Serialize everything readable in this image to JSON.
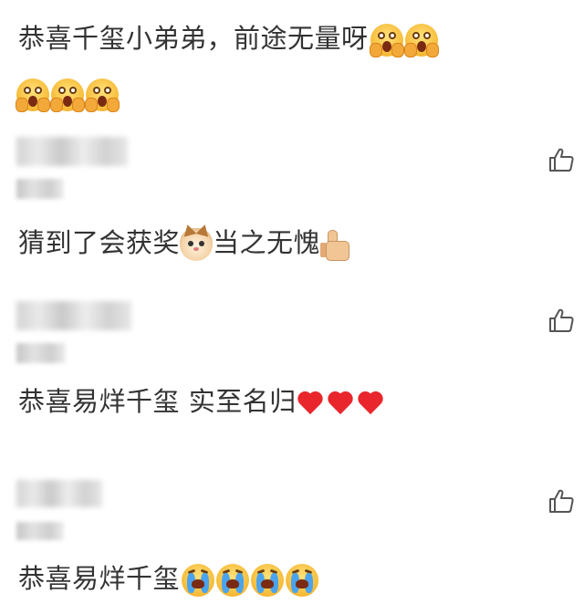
{
  "post": {
    "text_line1": "恭喜千玺小弟弟，前途无量呀",
    "line1_emoji": [
      "shocked-face-emoji",
      "shocked-face-emoji"
    ],
    "line2_emoji": [
      "shocked-face-emoji",
      "shocked-face-emoji",
      "shocked-face-emoji"
    ]
  },
  "comments": [
    {
      "text_a": "猜到了会获奖",
      "text_b": "当之无愧",
      "emoji": [
        "cat-face-emoji",
        "thumbs-up-emoji"
      ]
    },
    {
      "text": "恭喜易烊千玺 实至名归",
      "emoji": [
        "red-heart-emoji",
        "red-heart-emoji",
        "red-heart-emoji"
      ]
    },
    {
      "text": "恭喜易烊千玺",
      "emoji": [
        "crying-face-emoji",
        "crying-face-emoji",
        "crying-face-emoji",
        "crying-face-emoji"
      ]
    }
  ],
  "icons": {
    "like": "thumbs-up-outline-icon"
  },
  "colors": {
    "text": "#333333",
    "icon": "#555555",
    "heart": "#e8262b"
  }
}
